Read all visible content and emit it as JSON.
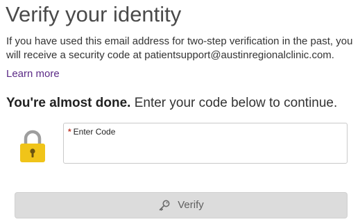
{
  "page": {
    "title": "Verify your identity",
    "intro": "If you have used this email address for two-step verification in the past, you will receive a security code at patientsupport@austinregionalclinic.com.",
    "learn_more": "Learn more"
  },
  "subtitle": {
    "strong": "You're almost done.",
    "rest": " Enter your code below to continue."
  },
  "code_field": {
    "required_marker": "*",
    "label": "Enter Code",
    "value": "",
    "placeholder": ""
  },
  "verify_button": {
    "label": "Verify",
    "icon": "key-icon",
    "disabled": true
  },
  "colors": {
    "link": "#5b2a86",
    "lock_body": "#f0c419",
    "lock_shackle": "#9e9e9e",
    "button_bg": "#dcdcdc",
    "required": "#c0392b"
  },
  "icons": {
    "lock": "lock-icon",
    "key": "key-icon"
  }
}
